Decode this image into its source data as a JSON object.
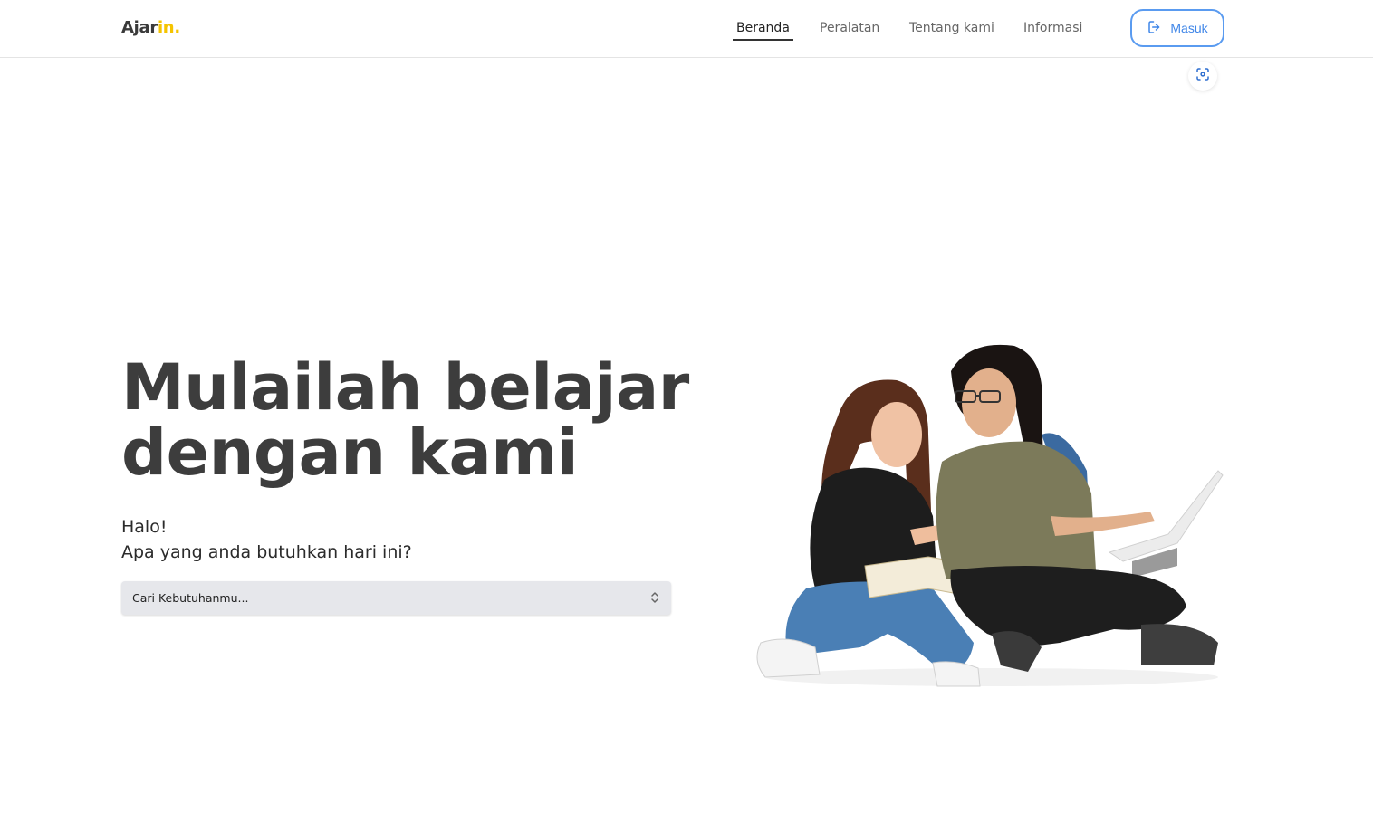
{
  "brand": {
    "name_main": "Ajar",
    "name_accent": "in.",
    "accent_color": "#f5c400"
  },
  "nav": {
    "items": [
      {
        "label": "Beranda",
        "active": true
      },
      {
        "label": "Peralatan",
        "active": false
      },
      {
        "label": "Tentang kami",
        "active": false
      },
      {
        "label": "Informasi",
        "active": false
      }
    ]
  },
  "login": {
    "label": "Masuk",
    "icon": "login-icon",
    "color": "#3f86e8"
  },
  "scan": {
    "icon": "scan-icon"
  },
  "hero": {
    "title_line1": "Mulailah belajar",
    "title_line2": "dengan kami",
    "greeting_line1": "Halo!",
    "greeting_line2": "Apa yang anda butuhkan hari ini?"
  },
  "search_select": {
    "value": "Cari Kebutuhanmu...",
    "icon": "chevron-updown-icon"
  }
}
